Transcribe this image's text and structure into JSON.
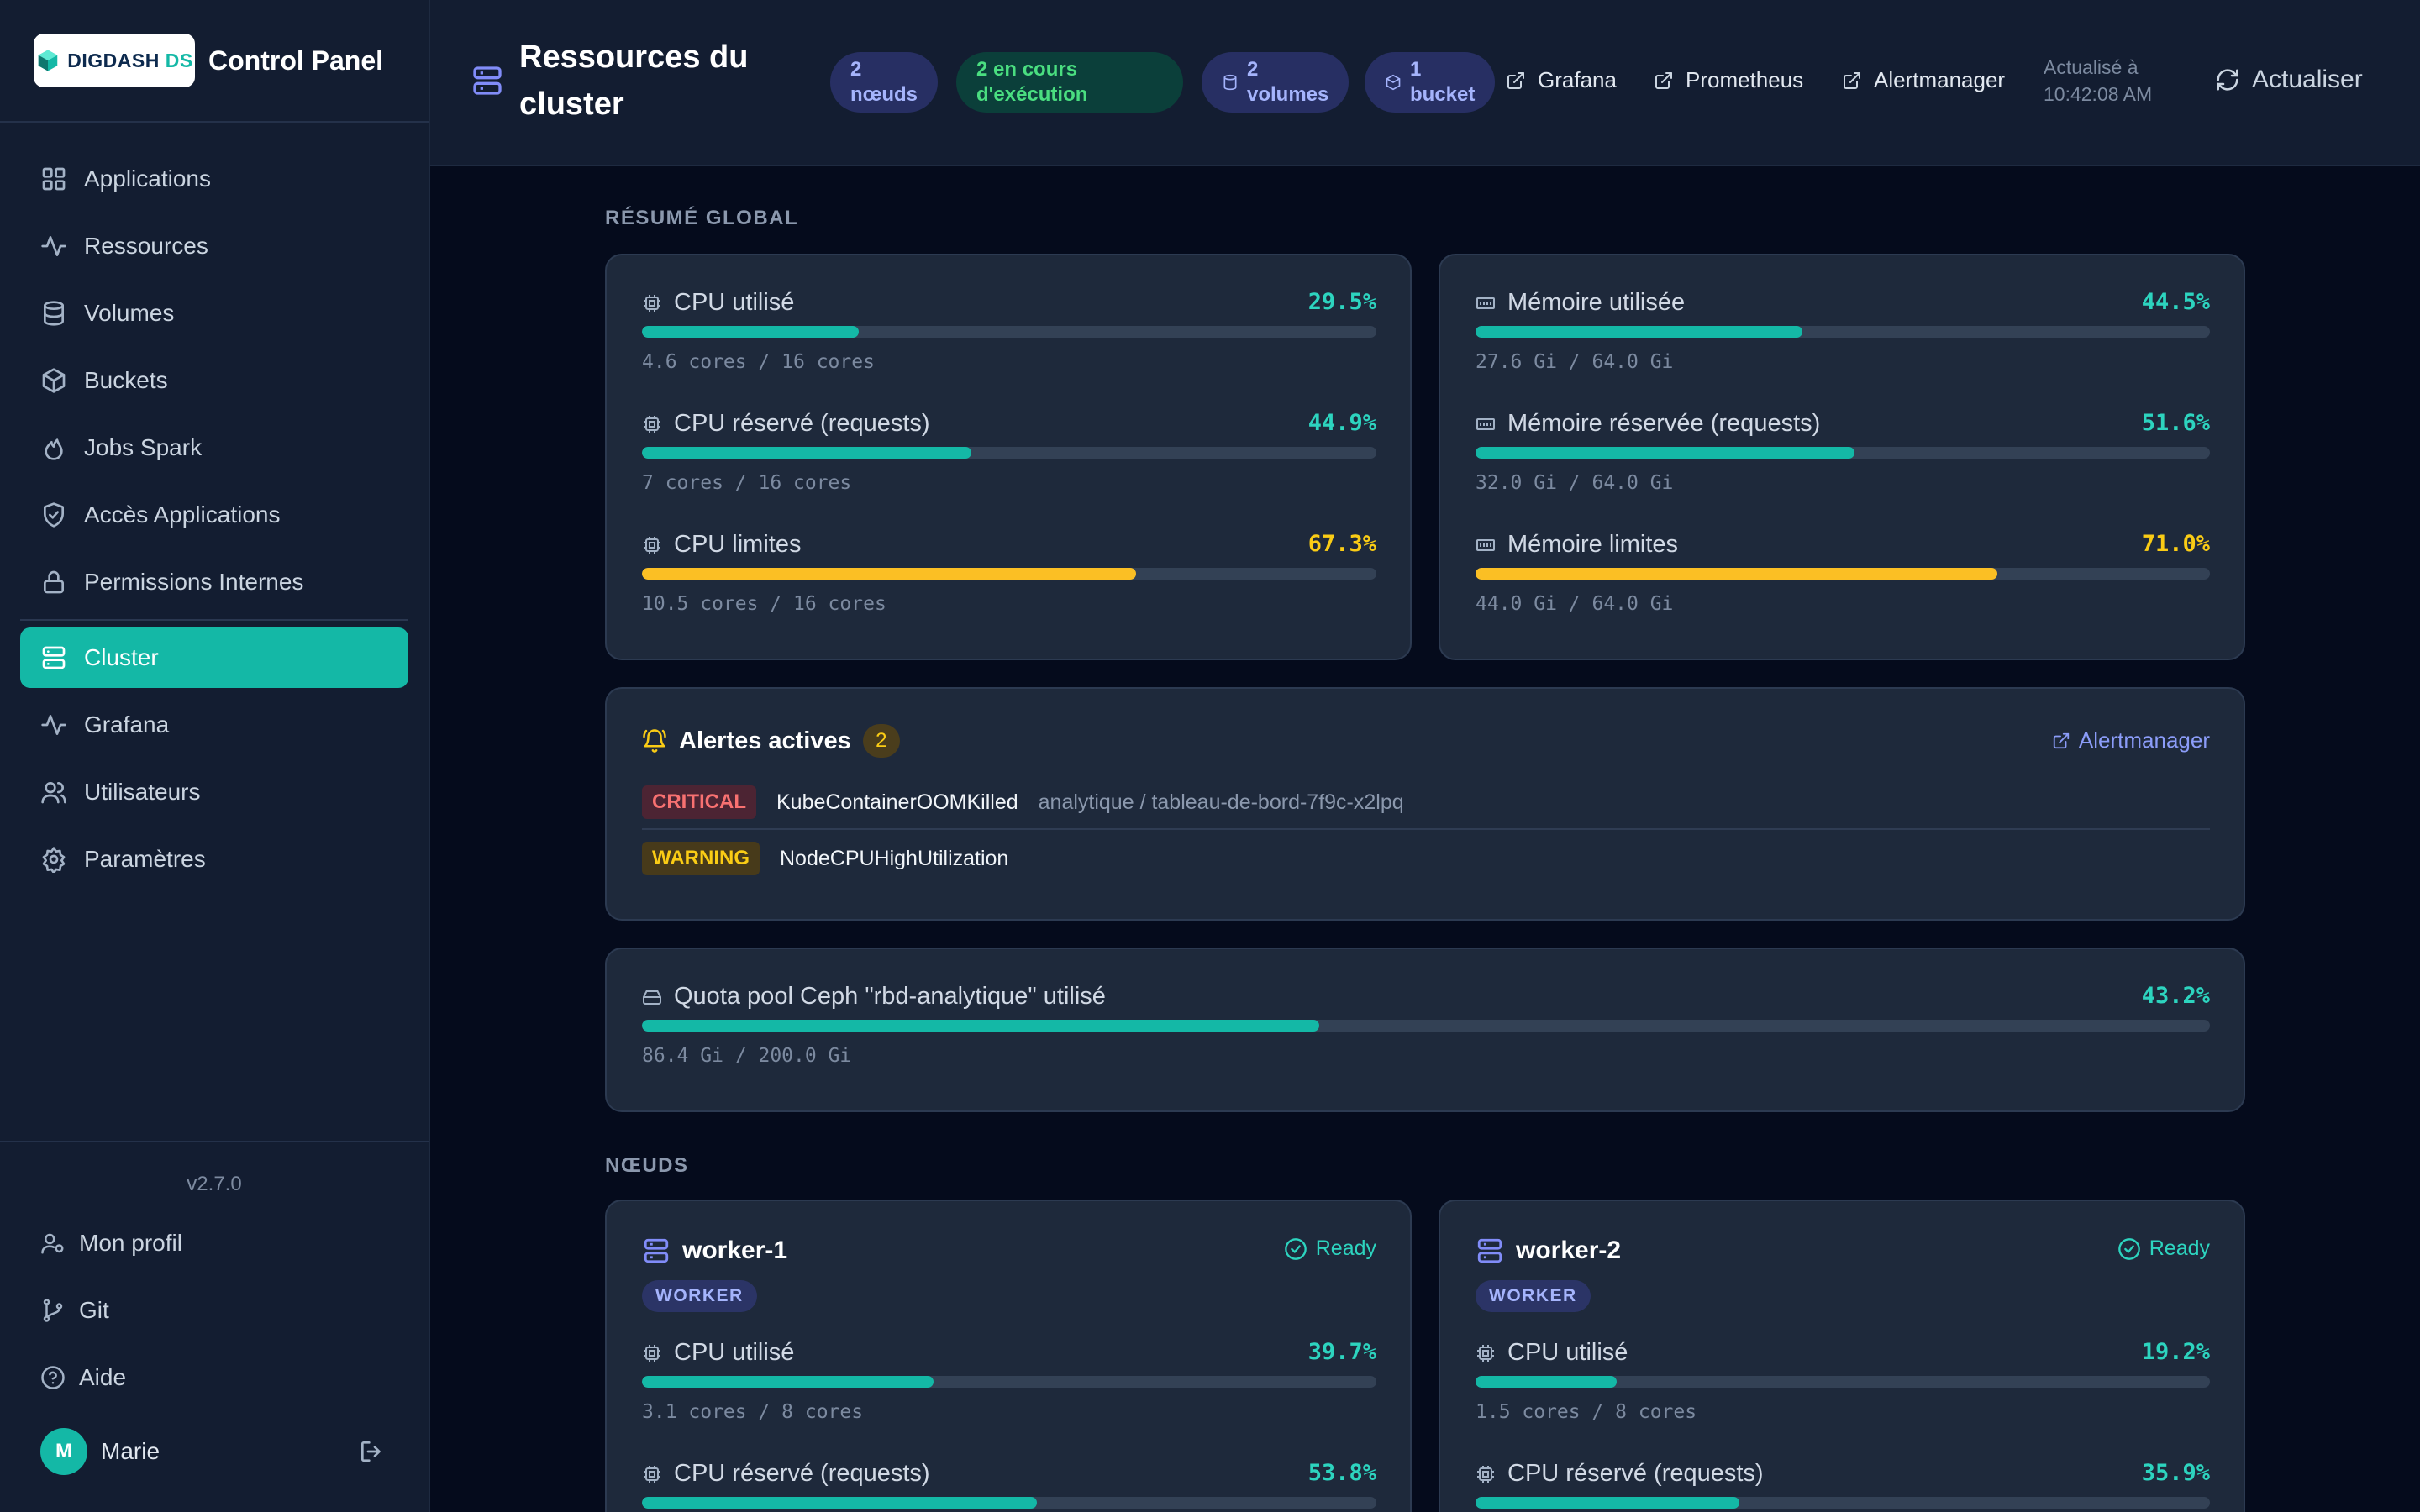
{
  "sidebar": {
    "logo": {
      "main": "DIGDASH",
      "suffix": "DS"
    },
    "title": "Control Panel",
    "items": [
      {
        "label": "Applications",
        "icon": "grid-icon"
      },
      {
        "label": "Ressources",
        "icon": "activity-icon"
      },
      {
        "label": "Volumes",
        "icon": "database-icon"
      },
      {
        "label": "Buckets",
        "icon": "package-icon"
      },
      {
        "label": "Jobs Spark",
        "icon": "flame-icon"
      },
      {
        "label": "Accès Applications",
        "icon": "shield-check-icon"
      },
      {
        "label": "Permissions Internes",
        "icon": "lock-icon"
      },
      {
        "label": "Cluster",
        "icon": "server-icon",
        "active": true
      },
      {
        "label": "Grafana",
        "icon": "activity-icon"
      },
      {
        "label": "Utilisateurs",
        "icon": "users-icon"
      },
      {
        "label": "Paramètres",
        "icon": "gear-icon"
      }
    ],
    "version": "v2.7.0",
    "footer": [
      {
        "label": "Mon profil",
        "icon": "user-cog-icon"
      },
      {
        "label": "Git",
        "icon": "git-branch-icon"
      },
      {
        "label": "Aide",
        "icon": "help-circle-icon"
      }
    ],
    "user": {
      "initial": "M",
      "name": "Marie"
    }
  },
  "header": {
    "title": "Ressources du cluster",
    "pills": [
      {
        "label": "2 nœuds",
        "line1": "2",
        "line2": "nœuds"
      },
      {
        "label": "2 en cours d'exécution",
        "line1": "2 en cours",
        "line2": "d'exécution"
      },
      {
        "label": "2 volumes",
        "line1": "2",
        "line2": "volumes"
      },
      {
        "label": "1 bucket",
        "line1": "1",
        "line2": "bucket"
      }
    ],
    "links": {
      "grafana": "Grafana",
      "prometheus": "Prometheus",
      "alertmanager": "Alertmanager"
    },
    "updated_line1": "Actualisé à",
    "updated_line2": "10:42:08 AM",
    "refresh_label": "Actualiser"
  },
  "summary": {
    "section_title": "RÉSUMÉ GLOBAL",
    "cpu": [
      {
        "label": "CPU utilisé",
        "pct": "29.5%",
        "value": 29.5,
        "sub": "4.6 cores / 16 cores",
        "level": "normal"
      },
      {
        "label": "CPU réservé (requests)",
        "pct": "44.9%",
        "value": 44.9,
        "sub": "7 cores / 16 cores",
        "level": "normal"
      },
      {
        "label": "CPU limites",
        "pct": "67.3%",
        "value": 67.3,
        "sub": "10.5 cores / 16 cores",
        "level": "warning"
      }
    ],
    "memory": [
      {
        "label": "Mémoire utilisée",
        "pct": "44.5%",
        "value": 44.5,
        "sub": "27.6 Gi / 64.0 Gi",
        "level": "normal"
      },
      {
        "label": "Mémoire réservée (requests)",
        "pct": "51.6%",
        "value": 51.6,
        "sub": "32.0 Gi / 64.0 Gi",
        "level": "normal"
      },
      {
        "label": "Mémoire limites",
        "pct": "71.0%",
        "value": 71.0,
        "sub": "44.0 Gi / 64.0 Gi",
        "level": "warning"
      }
    ]
  },
  "alerts": {
    "title": "Alertes actives",
    "count": "2",
    "link_label": "Alertmanager",
    "items": [
      {
        "severity": "CRITICAL",
        "name": "KubeContainerOOMKilled",
        "target": "analytique / tableau-de-bord-7f9c-x2lpq"
      },
      {
        "severity": "WARNING",
        "name": "NodeCPUHighUtilization",
        "target": ""
      }
    ]
  },
  "quota": {
    "label": "Quota pool Ceph \"rbd-analytique\" utilisé",
    "pct": "43.2%",
    "value": 43.2,
    "sub": "86.4 Gi / 200.0 Gi"
  },
  "nodes": {
    "section_title": "NŒUDS",
    "items": [
      {
        "name": "worker-1",
        "status": "Ready",
        "role": "WORKER",
        "metrics": [
          {
            "label": "CPU utilisé",
            "pct": "39.7%",
            "value": 39.7,
            "sub": "3.1 cores / 8 cores"
          },
          {
            "label": "CPU réservé (requests)",
            "pct": "53.8%",
            "value": 53.8,
            "sub": ""
          }
        ]
      },
      {
        "name": "worker-2",
        "status": "Ready",
        "role": "WORKER",
        "metrics": [
          {
            "label": "CPU utilisé",
            "pct": "19.2%",
            "value": 19.2,
            "sub": "1.5 cores / 8 cores"
          },
          {
            "label": "CPU réservé (requests)",
            "pct": "35.9%",
            "value": 35.9,
            "sub": ""
          }
        ]
      }
    ]
  },
  "colors": {
    "accent": "#14b8a6",
    "warning": "#fbbf24",
    "indigo": "#818cf8",
    "critical": "#f87171"
  }
}
